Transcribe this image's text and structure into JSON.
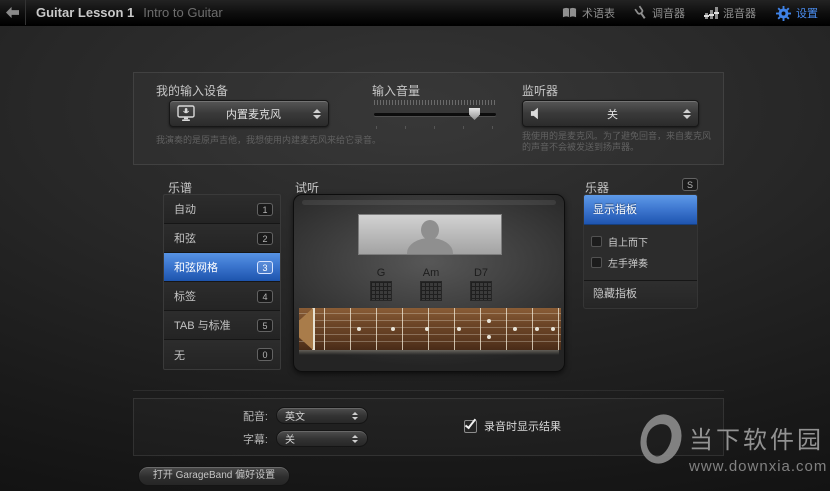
{
  "titlebar": {
    "title": "Guitar Lesson 1",
    "subtitle": "Intro to Guitar",
    "tools": [
      {
        "label": "术语表",
        "icon": "glossary-book-icon"
      },
      {
        "label": "调音器",
        "icon": "tuner-fork-icon"
      },
      {
        "label": "混音器",
        "icon": "mixer-icon"
      },
      {
        "label": "设置",
        "icon": "settings-gear-icon",
        "active": true
      }
    ]
  },
  "setup": {
    "input_device": {
      "label": "我的输入设备",
      "value": "内置麦克风",
      "help": "我演奏的是原声吉他，我想使用内建麦克风来给它录音。"
    },
    "input_volume": {
      "label": "输入音量",
      "value_percent": 82
    },
    "monitor": {
      "label": "监听器",
      "value": "关",
      "help": "我使用的是麦克风。为了避免回音，来自麦克风的声音不会被发送到扬声器。"
    }
  },
  "notation": {
    "label": "乐谱",
    "items": [
      {
        "label": "自动",
        "key": "1",
        "selected": false
      },
      {
        "label": "和弦",
        "key": "2",
        "selected": false
      },
      {
        "label": "和弦网格",
        "key": "3",
        "selected": true
      },
      {
        "label": "标签",
        "key": "4",
        "selected": false
      },
      {
        "label": "TAB 与标准",
        "key": "5",
        "selected": false
      },
      {
        "label": "无",
        "key": "0",
        "selected": false
      }
    ]
  },
  "preview": {
    "label": "试听",
    "chords": [
      {
        "name": "G"
      },
      {
        "name": "Am"
      },
      {
        "name": "D7"
      }
    ]
  },
  "instrument": {
    "label": "乐器",
    "key": "S",
    "show_fretboard": "显示指板",
    "options": [
      {
        "label": "自上而下",
        "checked": false
      },
      {
        "label": "左手弹奏",
        "checked": false
      }
    ],
    "hide_fretboard": "隐藏指板"
  },
  "footer": {
    "voice_label": "配音:",
    "voice_value": "英文",
    "subtitles_label": "字幕:",
    "subtitles_value": "关",
    "record_checkbox": {
      "label": "录音时显示结果",
      "checked": true
    }
  },
  "prefs_button_label": "打开 GarageBand 偏好设置",
  "watermark": {
    "site_name": "当下软件园",
    "site_url": "www.downxia.com"
  },
  "colors": {
    "accent_blue": "#3d76cf",
    "selected_item_top": "#5793e4",
    "selected_item_bottom": "#1d54ad",
    "settings_label_blue": "#4a8df0",
    "watermark_gray": "#8f8f8f"
  }
}
